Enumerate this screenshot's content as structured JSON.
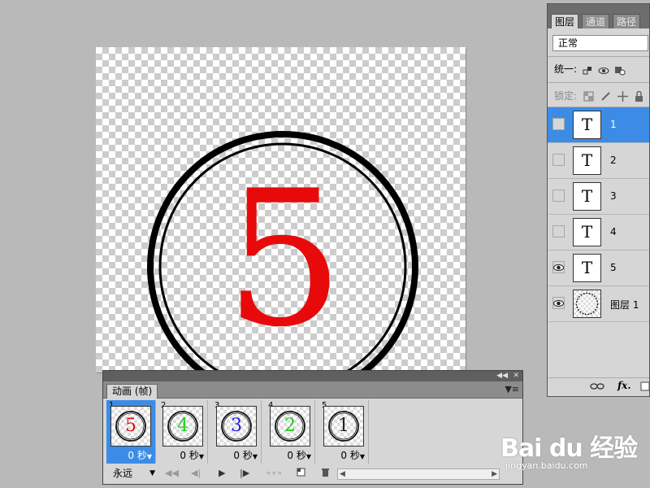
{
  "canvas": {
    "digit": "5",
    "digit_color": "#e80a0a",
    "ring_color": "#000000"
  },
  "layers_panel": {
    "tabs": [
      "图层",
      "通道",
      "路径"
    ],
    "blend_mode": "正常",
    "unify_label": "统一:",
    "lock_label": "锁定:",
    "layers": [
      {
        "name": "1",
        "thumb": "T",
        "visible": false,
        "selected": true
      },
      {
        "name": "2",
        "thumb": "T",
        "visible": false,
        "selected": false
      },
      {
        "name": "3",
        "thumb": "T",
        "visible": false,
        "selected": false
      },
      {
        "name": "4",
        "thumb": "T",
        "visible": false,
        "selected": false
      },
      {
        "name": "5",
        "thumb": "T",
        "visible": true,
        "selected": false
      },
      {
        "name": "图层 1",
        "thumb": "",
        "visible": true,
        "selected": false
      }
    ],
    "bottom_icons": [
      "link-icon",
      "fx-icon",
      "new-layer-icon"
    ],
    "fx_label": "fx."
  },
  "animation_panel": {
    "tab_label": "动画 (帧)",
    "frames": [
      {
        "number": "1",
        "digit": "5",
        "color": "#e01010",
        "delay": "0 秒",
        "selected": true
      },
      {
        "number": "2",
        "digit": "4",
        "color": "#22cc22",
        "delay": "0 秒",
        "selected": false
      },
      {
        "number": "3",
        "digit": "3",
        "color": "#2222dd",
        "delay": "0 秒",
        "selected": false
      },
      {
        "number": "4",
        "digit": "2",
        "color": "#22cc22",
        "delay": "0 秒",
        "selected": false
      },
      {
        "number": "5",
        "digit": "1",
        "color": "#222222",
        "delay": "0 秒",
        "selected": false
      }
    ],
    "loop_option": "永远",
    "controls": [
      "first-frame-icon",
      "prev-frame-icon",
      "play-icon",
      "next-frame-icon",
      "tween-icon",
      "duplicate-frame-icon",
      "delete-frame-icon"
    ]
  },
  "watermark": {
    "logo": "Bai du 经验",
    "url": "jingyan.baidu.com"
  }
}
